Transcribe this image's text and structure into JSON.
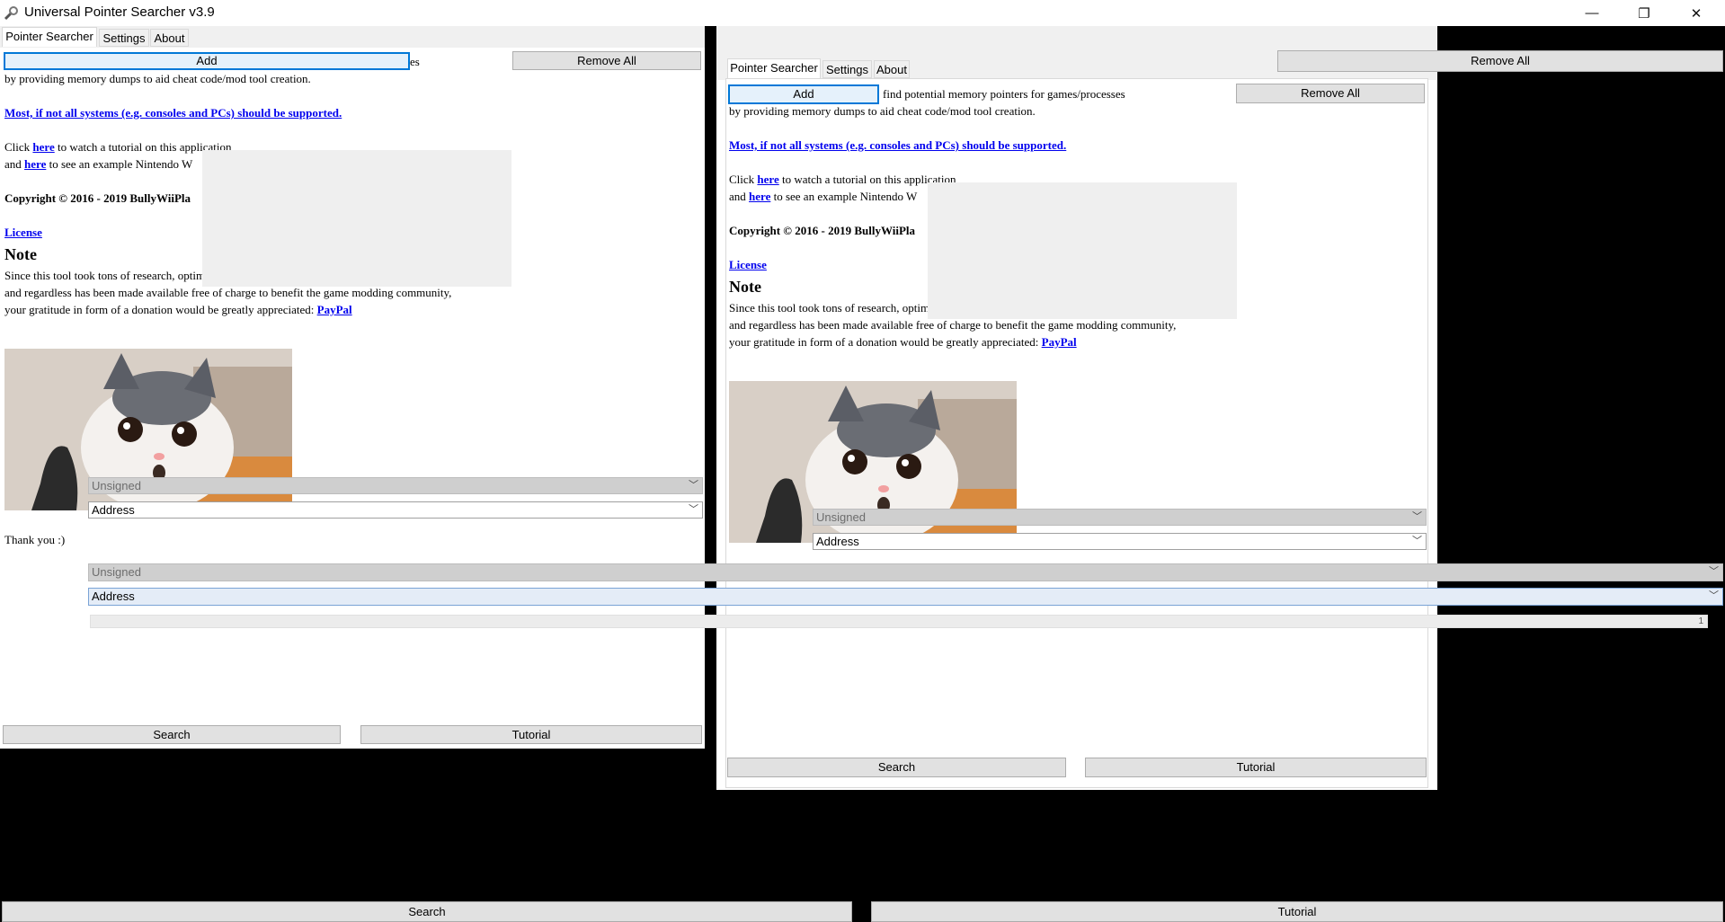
{
  "window": {
    "title": "Universal Pointer Searcher v3.9"
  },
  "controls": {
    "minimize": "—",
    "maximize": "❐",
    "close": "✕"
  },
  "tabs": [
    "Pointer Searcher",
    "Settings",
    "About"
  ],
  "buttons": {
    "add": "Add",
    "remove_all": "Remove All",
    "search": "Search",
    "tutorial": "Tutorial"
  },
  "about": {
    "line1_tail_clipped": "es",
    "line1_tail": "find potential memory pointers for games/processes",
    "line2": "by providing memory dumps to aid cheat code/mod tool creation.",
    "support_link": "Most, if not all systems (e.g. consoles and PCs) should be supported.",
    "click": "Click",
    "here1": "here",
    "tutorial_tail": "to watch a tutorial on this application",
    "and": "and",
    "here2": "here",
    "example_tail": "to see an example Nintendo W",
    "copyright": "Copyright © 2016 - 2019 BullyWiiPla",
    "license": "License",
    "note_heading": "Note",
    "note1": "Since this tool took tons of research, optimization, testing and debugging over years",
    "note2": "and regardless has been made available free of charge to benefit the game modding community,",
    "note3": "your gratitude in form of a donation would be greatly appreciated:",
    "paypal": "PayPal",
    "thanks": "Thank you :)"
  },
  "dropdowns": {
    "type_value": "Unsigned",
    "kind_value": "Address"
  },
  "progress": {
    "value_text": "1"
  }
}
